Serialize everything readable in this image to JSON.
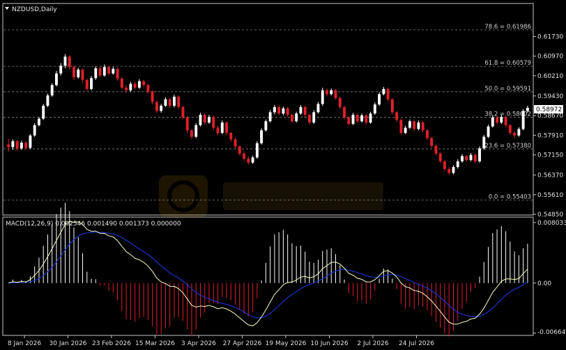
{
  "chart_header": {
    "symbol_label": "NZDUSD,Daily",
    "menu_icon": "triangle-down-icon"
  },
  "indicator_header": {
    "label": "MACD(12,26,9) 0.002546 0.001490 0.001373 0.000000"
  },
  "price_marker": {
    "value": "0.58972",
    "color": "#ffffff"
  },
  "watermark": {
    "icon": "wikifx-logo-icon"
  },
  "colors": {
    "bull": "#ffffff",
    "bear": "#e0202a",
    "macd_line": "#ffffc0",
    "signal_line": "#1a33cc",
    "background": "#000000"
  },
  "chart_data": [
    {
      "type": "candlestick",
      "title": "NZDUSD,Daily",
      "ylim": [
        0.5485,
        0.6255
      ],
      "y_ticks": [
        "0.61730",
        "0.60970",
        "0.60210",
        "0.59430",
        "0.58670",
        "0.57910",
        "0.57150",
        "0.56370",
        "0.55610",
        "0.54850"
      ],
      "x_ticks": [
        "8 Jan 2026",
        "30 Jan 2026",
        "23 Feb 2026",
        "15 Mar 2026",
        "3 Apr 2026",
        "27 Apr 2026",
        "19 May 2026",
        "10 Jun 2026",
        "2 Jul 2026",
        "24 Jul 2026"
      ],
      "fibo_levels": [
        {
          "label": "78.6 = 0.61986",
          "value": 0.61986
        },
        {
          "label": "61.8 = 0.60579",
          "value": 0.60579
        },
        {
          "label": "50.0 = 0.59591",
          "value": 0.59591
        },
        {
          "label": "38.2 = 0.58602",
          "value": 0.58602
        },
        {
          "label": "23.6 = 0.57380",
          "value": 0.5738
        },
        {
          "label": "0.0 = 0.55403",
          "value": 0.55403
        }
      ],
      "candles": [
        [
          0.5755,
          0.5745,
          0.5778,
          0.5728
        ],
        [
          0.5745,
          0.5768,
          0.5775,
          0.5735
        ],
        [
          0.5768,
          0.574,
          0.5772,
          0.5732
        ],
        [
          0.574,
          0.5762,
          0.577,
          0.5735
        ],
        [
          0.5762,
          0.5742,
          0.5768,
          0.5734
        ],
        [
          0.5742,
          0.579,
          0.5795,
          0.5738
        ],
        [
          0.579,
          0.583,
          0.5838,
          0.5785
        ],
        [
          0.583,
          0.5855,
          0.5862,
          0.5825
        ],
        [
          0.5855,
          0.5905,
          0.5912,
          0.585
        ],
        [
          0.5905,
          0.5945,
          0.5952,
          0.59
        ],
        [
          0.5945,
          0.5985,
          0.5992,
          0.594
        ],
        [
          0.5985,
          0.603,
          0.604,
          0.598
        ],
        [
          0.603,
          0.606,
          0.607,
          0.6022
        ],
        [
          0.606,
          0.6095,
          0.6105,
          0.605
        ],
        [
          0.6095,
          0.6055,
          0.61,
          0.6045
        ],
        [
          0.6055,
          0.6015,
          0.6062,
          0.6005
        ],
        [
          0.6015,
          0.6045,
          0.6052,
          0.601
        ],
        [
          0.6045,
          0.6005,
          0.605,
          0.5995
        ],
        [
          0.6005,
          0.597,
          0.601,
          0.5962
        ],
        [
          0.597,
          0.6012,
          0.602,
          0.5965
        ],
        [
          0.6012,
          0.605,
          0.6058,
          0.6005
        ],
        [
          0.605,
          0.6022,
          0.6058,
          0.6015
        ],
        [
          0.6022,
          0.6055,
          0.6065,
          0.6018
        ],
        [
          0.6055,
          0.603,
          0.606,
          0.6022
        ],
        [
          0.603,
          0.6048,
          0.6055,
          0.6025
        ],
        [
          0.6048,
          0.601,
          0.6052,
          0.6002
        ],
        [
          0.601,
          0.5975,
          0.6015,
          0.5968
        ],
        [
          0.5975,
          0.5965,
          0.5985,
          0.5955
        ],
        [
          0.5965,
          0.599,
          0.5998,
          0.5958
        ],
        [
          0.599,
          0.5975,
          0.5998,
          0.5968
        ],
        [
          0.5975,
          0.6,
          0.6008,
          0.597
        ],
        [
          0.6,
          0.5985,
          0.6005,
          0.5978
        ],
        [
          0.5985,
          0.596,
          0.599,
          0.5952
        ],
        [
          0.596,
          0.592,
          0.5965,
          0.591
        ],
        [
          0.592,
          0.5885,
          0.5925,
          0.5878
        ],
        [
          0.5885,
          0.5905,
          0.5912,
          0.5878
        ],
        [
          0.5905,
          0.593,
          0.5938,
          0.59
        ],
        [
          0.593,
          0.5905,
          0.5935,
          0.5895
        ],
        [
          0.5905,
          0.594,
          0.5948,
          0.5898
        ],
        [
          0.594,
          0.59,
          0.5945,
          0.5892
        ],
        [
          0.59,
          0.586,
          0.5905,
          0.5852
        ],
        [
          0.586,
          0.581,
          0.5865,
          0.58
        ],
        [
          0.581,
          0.5785,
          0.5815,
          0.5775
        ],
        [
          0.5785,
          0.583,
          0.5838,
          0.578
        ],
        [
          0.583,
          0.587,
          0.5878,
          0.5825
        ],
        [
          0.587,
          0.584,
          0.5875,
          0.5832
        ],
        [
          0.584,
          0.5862,
          0.587,
          0.5835
        ],
        [
          0.5862,
          0.582,
          0.5868,
          0.5812
        ],
        [
          0.582,
          0.58,
          0.5828,
          0.579
        ],
        [
          0.58,
          0.584,
          0.5848,
          0.5795
        ],
        [
          0.584,
          0.58,
          0.5845,
          0.579
        ],
        [
          0.58,
          0.5775,
          0.5805,
          0.5765
        ],
        [
          0.5775,
          0.5748,
          0.5782,
          0.574
        ],
        [
          0.5748,
          0.572,
          0.5752,
          0.5712
        ],
        [
          0.572,
          0.57,
          0.5728,
          0.5692
        ],
        [
          0.57,
          0.5685,
          0.5708,
          0.5678
        ],
        [
          0.5685,
          0.5705,
          0.5712,
          0.568
        ],
        [
          0.5705,
          0.576,
          0.5768,
          0.57
        ],
        [
          0.576,
          0.581,
          0.5818,
          0.5755
        ],
        [
          0.581,
          0.5845,
          0.5852,
          0.5805
        ],
        [
          0.5845,
          0.588,
          0.5888,
          0.584
        ],
        [
          0.588,
          0.59,
          0.5908,
          0.5872
        ],
        [
          0.59,
          0.5875,
          0.5905,
          0.5868
        ],
        [
          0.5875,
          0.5895,
          0.5902,
          0.5868
        ],
        [
          0.5895,
          0.587,
          0.59,
          0.5862
        ],
        [
          0.587,
          0.5845,
          0.5875,
          0.5838
        ],
        [
          0.5845,
          0.5875,
          0.5882,
          0.584
        ],
        [
          0.5875,
          0.59,
          0.5908,
          0.587
        ],
        [
          0.59,
          0.587,
          0.5905,
          0.5862
        ],
        [
          0.587,
          0.584,
          0.5875,
          0.5832
        ],
        [
          0.584,
          0.588,
          0.5888,
          0.5835
        ],
        [
          0.588,
          0.5912,
          0.592,
          0.5875
        ],
        [
          0.5912,
          0.5965,
          0.5975,
          0.5905
        ],
        [
          0.5965,
          0.595,
          0.5972,
          0.5942
        ],
        [
          0.595,
          0.5965,
          0.5972,
          0.5945
        ],
        [
          0.5965,
          0.5935,
          0.597,
          0.5928
        ],
        [
          0.5935,
          0.59,
          0.594,
          0.5892
        ],
        [
          0.59,
          0.586,
          0.5905,
          0.5852
        ],
        [
          0.586,
          0.5835,
          0.5865,
          0.5828
        ],
        [
          0.5835,
          0.587,
          0.5878,
          0.583
        ],
        [
          0.587,
          0.5845,
          0.5875,
          0.5838
        ],
        [
          0.5845,
          0.5868,
          0.5875,
          0.584
        ],
        [
          0.5868,
          0.584,
          0.5872,
          0.5832
        ],
        [
          0.584,
          0.5875,
          0.5882,
          0.5835
        ],
        [
          0.5875,
          0.591,
          0.5918,
          0.587
        ],
        [
          0.591,
          0.595,
          0.5958,
          0.5905
        ],
        [
          0.595,
          0.597,
          0.5978,
          0.5945
        ],
        [
          0.597,
          0.593,
          0.5975,
          0.5922
        ],
        [
          0.593,
          0.588,
          0.5935,
          0.5872
        ],
        [
          0.588,
          0.585,
          0.5885,
          0.5842
        ],
        [
          0.585,
          0.58,
          0.5855,
          0.5792
        ],
        [
          0.58,
          0.582,
          0.5828,
          0.5795
        ],
        [
          0.582,
          0.5845,
          0.5852,
          0.5815
        ],
        [
          0.5845,
          0.5815,
          0.585,
          0.5808
        ],
        [
          0.5815,
          0.584,
          0.5848,
          0.581
        ],
        [
          0.584,
          0.581,
          0.5845,
          0.5802
        ],
        [
          0.581,
          0.578,
          0.5815,
          0.5772
        ],
        [
          0.578,
          0.575,
          0.5785,
          0.5742
        ],
        [
          0.575,
          0.572,
          0.5755,
          0.5712
        ],
        [
          0.572,
          0.569,
          0.5725,
          0.5682
        ],
        [
          0.569,
          0.566,
          0.5695,
          0.5652
        ],
        [
          0.566,
          0.5645,
          0.5668,
          0.5638
        ],
        [
          0.5645,
          0.5668,
          0.5675,
          0.564
        ],
        [
          0.5668,
          0.569,
          0.5698,
          0.5662
        ],
        [
          0.569,
          0.571,
          0.5718,
          0.5685
        ],
        [
          0.571,
          0.5695,
          0.5715,
          0.5688
        ],
        [
          0.5695,
          0.5715,
          0.5722,
          0.569
        ],
        [
          0.5715,
          0.569,
          0.572,
          0.5682
        ],
        [
          0.569,
          0.574,
          0.5748,
          0.5685
        ],
        [
          0.574,
          0.5785,
          0.5792,
          0.5735
        ],
        [
          0.5785,
          0.5825,
          0.5832,
          0.578
        ],
        [
          0.5825,
          0.586,
          0.5868,
          0.582
        ],
        [
          0.586,
          0.584,
          0.5865,
          0.5832
        ],
        [
          0.584,
          0.5862,
          0.587,
          0.5835
        ],
        [
          0.5862,
          0.583,
          0.5868,
          0.5822
        ],
        [
          0.583,
          0.58,
          0.5835,
          0.5792
        ],
        [
          0.58,
          0.579,
          0.5808,
          0.578
        ],
        [
          0.579,
          0.5815,
          0.5822,
          0.5785
        ],
        [
          0.5815,
          0.5885,
          0.5892,
          0.581
        ],
        [
          0.5885,
          0.5897,
          0.5905,
          0.5878
        ]
      ]
    },
    {
      "type": "line",
      "title": "MACD(12,26,9) 0.002546 0.001490 0.001373 0.000000",
      "ylim": [
        -0.00685,
        0.0082
      ],
      "y_ticks": [
        "0.008033",
        "0.00",
        "-0.006647"
      ],
      "series": []
    }
  ]
}
